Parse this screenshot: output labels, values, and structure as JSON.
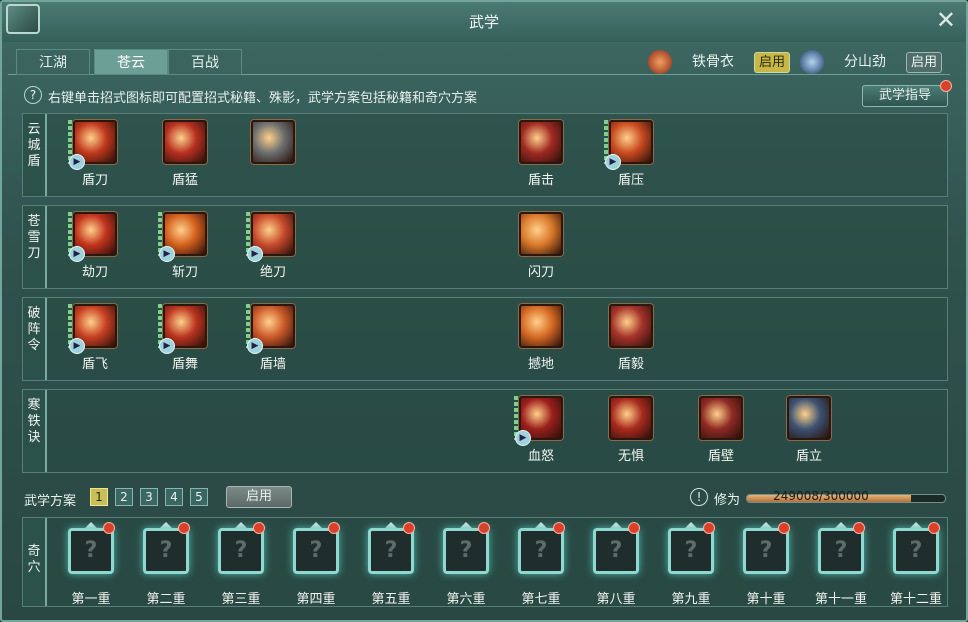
{
  "window": {
    "title": "武学",
    "close_icon": "close-icon",
    "logo_icon": "codex-icon"
  },
  "tabs": [
    {
      "label": "江湖",
      "active": false
    },
    {
      "label": "苍云",
      "active": true
    },
    {
      "label": "百战",
      "active": false
    }
  ],
  "indicators": [
    {
      "name": "铁骨衣",
      "button": "启用",
      "icon": "shield-emblem-icon"
    },
    {
      "name": "分山劲",
      "button": "启用",
      "icon": "blade-emblem-icon"
    }
  ],
  "hint": "右键单击招式图标即可配置招式秘籍、殊影，武学方案包括秘籍和奇穴方案",
  "guide_button": "武学指导",
  "rows": [
    {
      "label": "云\n城\n盾",
      "skills": [
        {
          "name": "盾刀",
          "color": "#c0381d",
          "bars": true,
          "play": true
        },
        {
          "name": "盾猛",
          "color": "#b73020",
          "bars": false,
          "play": false
        },
        {
          "name": "",
          "color": "#6b6e6f",
          "bars": false,
          "play": false
        },
        {
          "name": "盾击",
          "color": "#9f2a22",
          "bars": false,
          "play": false
        },
        {
          "name": "盾压",
          "color": "#c94a20",
          "bars": true,
          "play": true
        }
      ]
    },
    {
      "label": "苍\n雪\n刀",
      "skills": [
        {
          "name": "劫刀",
          "color": "#c2331d",
          "bars": true,
          "play": true
        },
        {
          "name": "斩刀",
          "color": "#d4601f",
          "bars": true,
          "play": true
        },
        {
          "name": "绝刀",
          "color": "#c84a2c",
          "bars": true,
          "play": true
        },
        {
          "name": "闪刀",
          "color": "#d9792a",
          "bars": false,
          "play": false
        }
      ]
    },
    {
      "label": "破\n阵\n令",
      "skills": [
        {
          "name": "盾飞",
          "color": "#c64022",
          "bars": true,
          "play": true
        },
        {
          "name": "盾舞",
          "color": "#b9341f",
          "bars": true,
          "play": true
        },
        {
          "name": "盾墙",
          "color": "#cc5a2a",
          "bars": true,
          "play": true
        },
        {
          "name": "撼地",
          "color": "#d66a24",
          "bars": false,
          "play": false
        },
        {
          "name": "盾毅",
          "color": "#a5332a",
          "bars": false,
          "play": false
        }
      ]
    },
    {
      "label": "寒\n铁\n诀",
      "skills": [
        {
          "name": "血怒",
          "color": "#9c1f1c",
          "bars": true,
          "play": true
        },
        {
          "name": "无惧",
          "color": "#a82a1e",
          "bars": false,
          "play": false
        },
        {
          "name": "盾壁",
          "color": "#8e2a24",
          "bars": false,
          "play": false
        },
        {
          "name": "盾立",
          "color": "#3c5272",
          "bars": false,
          "play": false
        }
      ]
    }
  ],
  "plan": {
    "label": "武学方案",
    "numbers": [
      "1",
      "2",
      "3",
      "4",
      "5"
    ],
    "selected": 0,
    "apply_button": "启用"
  },
  "cultivation": {
    "label": "修为",
    "current": 249008,
    "max": 300000,
    "text": "249008/300000"
  },
  "qixue": {
    "label": "奇\n穴",
    "slots": [
      "第一重",
      "第二重",
      "第三重",
      "第四重",
      "第五重",
      "第六重",
      "第七重",
      "第八重",
      "第九重",
      "第十重",
      "第十一重",
      "第十二重"
    ],
    "placeholder": "?"
  }
}
